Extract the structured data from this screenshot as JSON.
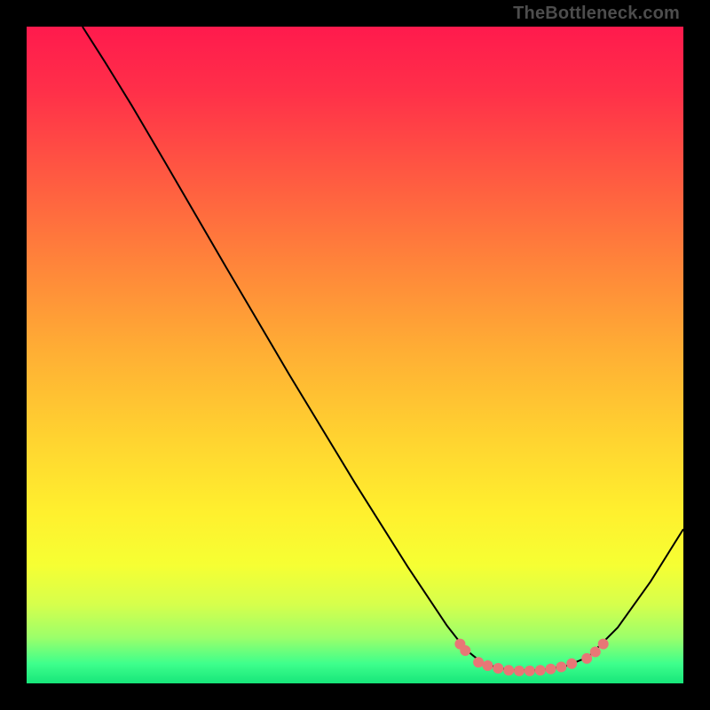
{
  "watermark": "TheBottleneck.com",
  "gradient_stops": [
    {
      "offset": 0.0,
      "color": "#ff1a4d"
    },
    {
      "offset": 0.1,
      "color": "#ff3049"
    },
    {
      "offset": 0.22,
      "color": "#ff5742"
    },
    {
      "offset": 0.36,
      "color": "#ff843a"
    },
    {
      "offset": 0.5,
      "color": "#ffb034"
    },
    {
      "offset": 0.63,
      "color": "#ffd430"
    },
    {
      "offset": 0.74,
      "color": "#fff02e"
    },
    {
      "offset": 0.82,
      "color": "#f6ff33"
    },
    {
      "offset": 0.88,
      "color": "#d6ff4c"
    },
    {
      "offset": 0.93,
      "color": "#9cff6a"
    },
    {
      "offset": 0.97,
      "color": "#3eff8c"
    },
    {
      "offset": 1.0,
      "color": "#17e67a"
    }
  ],
  "chart_data": {
    "type": "line",
    "title": "",
    "xlabel": "",
    "ylabel": "",
    "xlim_frac": [
      0,
      1
    ],
    "ylim_frac": [
      0,
      1
    ],
    "series": [
      {
        "name": "bottleneck-curve",
        "stroke": "#000000",
        "stroke_width": 2,
        "points": [
          {
            "x": 0.085,
            "y": 1.0
          },
          {
            "x": 0.12,
            "y": 0.945
          },
          {
            "x": 0.16,
            "y": 0.88
          },
          {
            "x": 0.21,
            "y": 0.795
          },
          {
            "x": 0.3,
            "y": 0.64
          },
          {
            "x": 0.4,
            "y": 0.47
          },
          {
            "x": 0.5,
            "y": 0.305
          },
          {
            "x": 0.58,
            "y": 0.178
          },
          {
            "x": 0.64,
            "y": 0.088
          },
          {
            "x": 0.668,
            "y": 0.052
          },
          {
            "x": 0.695,
            "y": 0.03
          },
          {
            "x": 0.735,
            "y": 0.02
          },
          {
            "x": 0.78,
            "y": 0.02
          },
          {
            "x": 0.82,
            "y": 0.026
          },
          {
            "x": 0.855,
            "y": 0.04
          },
          {
            "x": 0.9,
            "y": 0.085
          },
          {
            "x": 0.95,
            "y": 0.155
          },
          {
            "x": 1.0,
            "y": 0.235
          }
        ]
      },
      {
        "name": "bottom-markers",
        "type": "scatter",
        "fill": "#e87676",
        "radius": 6,
        "points": [
          {
            "x": 0.66,
            "y": 0.06
          },
          {
            "x": 0.668,
            "y": 0.05
          },
          {
            "x": 0.688,
            "y": 0.032
          },
          {
            "x": 0.702,
            "y": 0.027
          },
          {
            "x": 0.718,
            "y": 0.023
          },
          {
            "x": 0.734,
            "y": 0.02
          },
          {
            "x": 0.75,
            "y": 0.019
          },
          {
            "x": 0.766,
            "y": 0.019
          },
          {
            "x": 0.782,
            "y": 0.02
          },
          {
            "x": 0.798,
            "y": 0.022
          },
          {
            "x": 0.814,
            "y": 0.025
          },
          {
            "x": 0.83,
            "y": 0.03
          },
          {
            "x": 0.853,
            "y": 0.038
          },
          {
            "x": 0.866,
            "y": 0.048
          },
          {
            "x": 0.878,
            "y": 0.06
          }
        ]
      }
    ]
  }
}
